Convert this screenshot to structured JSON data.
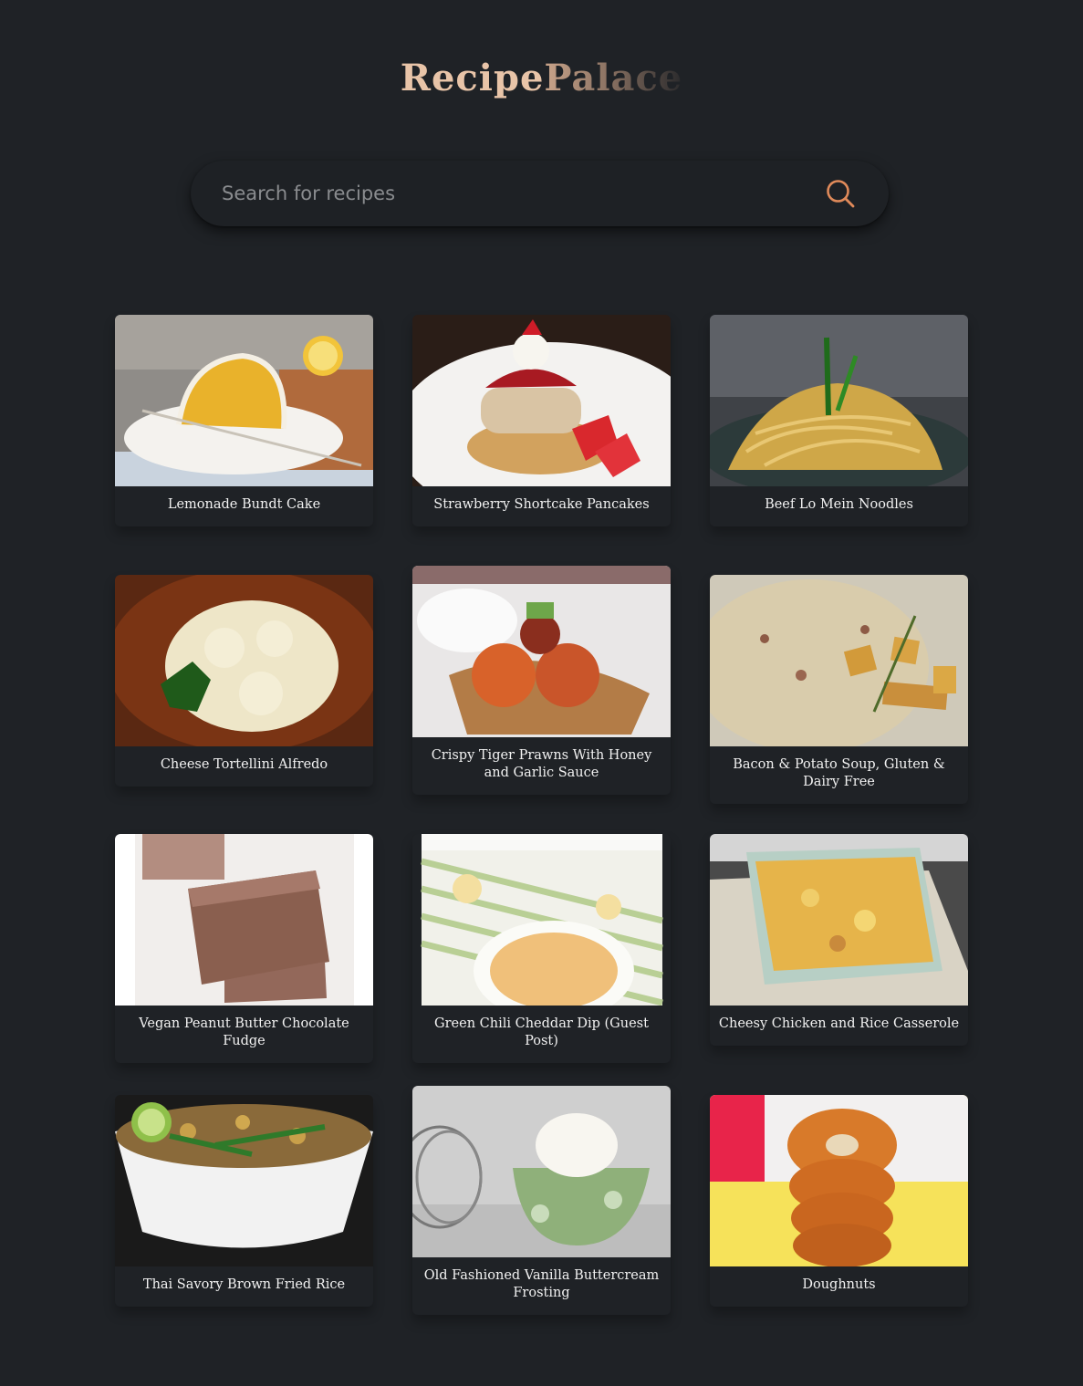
{
  "header": {
    "logo_part1": "Recipe",
    "logo_part2": "Palace"
  },
  "search": {
    "placeholder": "Search for recipes",
    "icon": "search-icon"
  },
  "recipes": [
    {
      "title": "Lemonade Bundt Cake"
    },
    {
      "title": "Strawberry Shortcake Pancakes"
    },
    {
      "title": "Beef Lo Mein Noodles"
    },
    {
      "title": "Cheese Tortellini Alfredo"
    },
    {
      "title": "Crispy Tiger Prawns With Honey and Garlic Sauce"
    },
    {
      "title": "Bacon & Potato Soup, Gluten & Dairy Free"
    },
    {
      "title": "Vegan Peanut Butter Chocolate Fudge"
    },
    {
      "title": "Green Chili Cheddar Dip (Guest Post)"
    },
    {
      "title": "Cheesy Chicken and Rice Casserole"
    },
    {
      "title": "Thai Savory Brown Fried Rice"
    },
    {
      "title": "Old Fashioned Vanilla Buttercream Frosting"
    },
    {
      "title": "Doughnuts"
    }
  ],
  "colors": {
    "background": "#1f2226",
    "accent": "#e08a5a"
  }
}
